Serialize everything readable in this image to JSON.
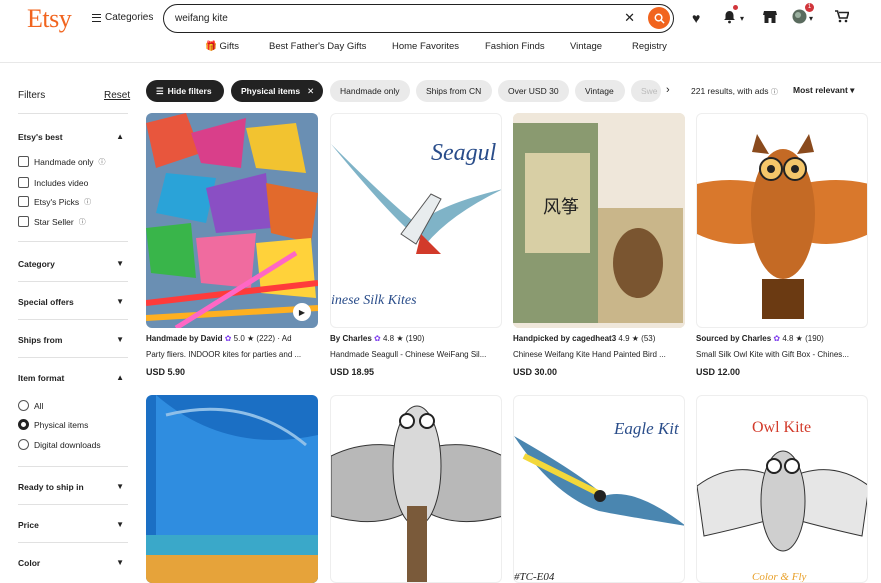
{
  "header": {
    "logo": "Etsy",
    "categories": "Categories",
    "search_value": "weifang kite",
    "cart_badge": "1"
  },
  "nav": [
    "Gifts",
    "Best Father's Day Gifts",
    "Home Favorites",
    "Fashion Finds",
    "Vintage",
    "Registry"
  ],
  "sidebar": {
    "title": "Filters",
    "reset": "Reset",
    "etsys_best": "Etsy's best",
    "best_options": [
      "Handmade only",
      "Includes video",
      "Etsy's Picks",
      "Star Seller"
    ],
    "category": "Category",
    "special_offers": "Special offers",
    "ships_from": "Ships from",
    "item_format": "Item format",
    "format_options": [
      "All",
      "Physical items",
      "Digital downloads"
    ],
    "format_selected": "Physical items",
    "ready_to_ship": "Ready to ship in",
    "price": "Price",
    "color": "Color"
  },
  "chips": [
    "Hide filters",
    "Physical items",
    "Handmade only",
    "Ships from CN",
    "Over USD 30",
    "Vintage",
    "Swe"
  ],
  "results": "221 results, with ads",
  "sort": "Most relevant",
  "colors": {
    "accent": "#f1641e",
    "dark": "#222222",
    "chip_bg": "#eaeaea",
    "purple": "#7c3aed"
  },
  "listings": [
    {
      "shop": "Handmade by David",
      "rating": "5.0",
      "reviews": "(222)",
      "ad": "· Ad",
      "desc": "Party fliers. INDOOR kites for parties and ...",
      "price": "USD 5.90"
    },
    {
      "shop": "By Charles",
      "rating": "4.8",
      "reviews": "(190)",
      "ad": "",
      "desc": "Handmade Seagull - Chinese WeiFang Sil...",
      "price": "USD 18.95"
    },
    {
      "shop": "Handpicked by cagedheat3",
      "rating": "4.9",
      "reviews": "(53)",
      "ad": "",
      "desc": "Chinese Weifang Kite Hand Painted Bird ...",
      "price": "USD 30.00"
    },
    {
      "shop": "Sourced by Charles",
      "rating": "4.8",
      "reviews": "(190)",
      "ad": "",
      "desc": "Small Silk Owl Kite with Gift Box - Chines...",
      "price": "USD 12.00"
    }
  ],
  "image_text": {
    "seagull": "Seagul",
    "silk": "inese Silk Kites",
    "eagle": "Eagle Kit",
    "owl": "Owl Kite",
    "code": "#TC-E04",
    "colorfly": "Color & Fly"
  }
}
